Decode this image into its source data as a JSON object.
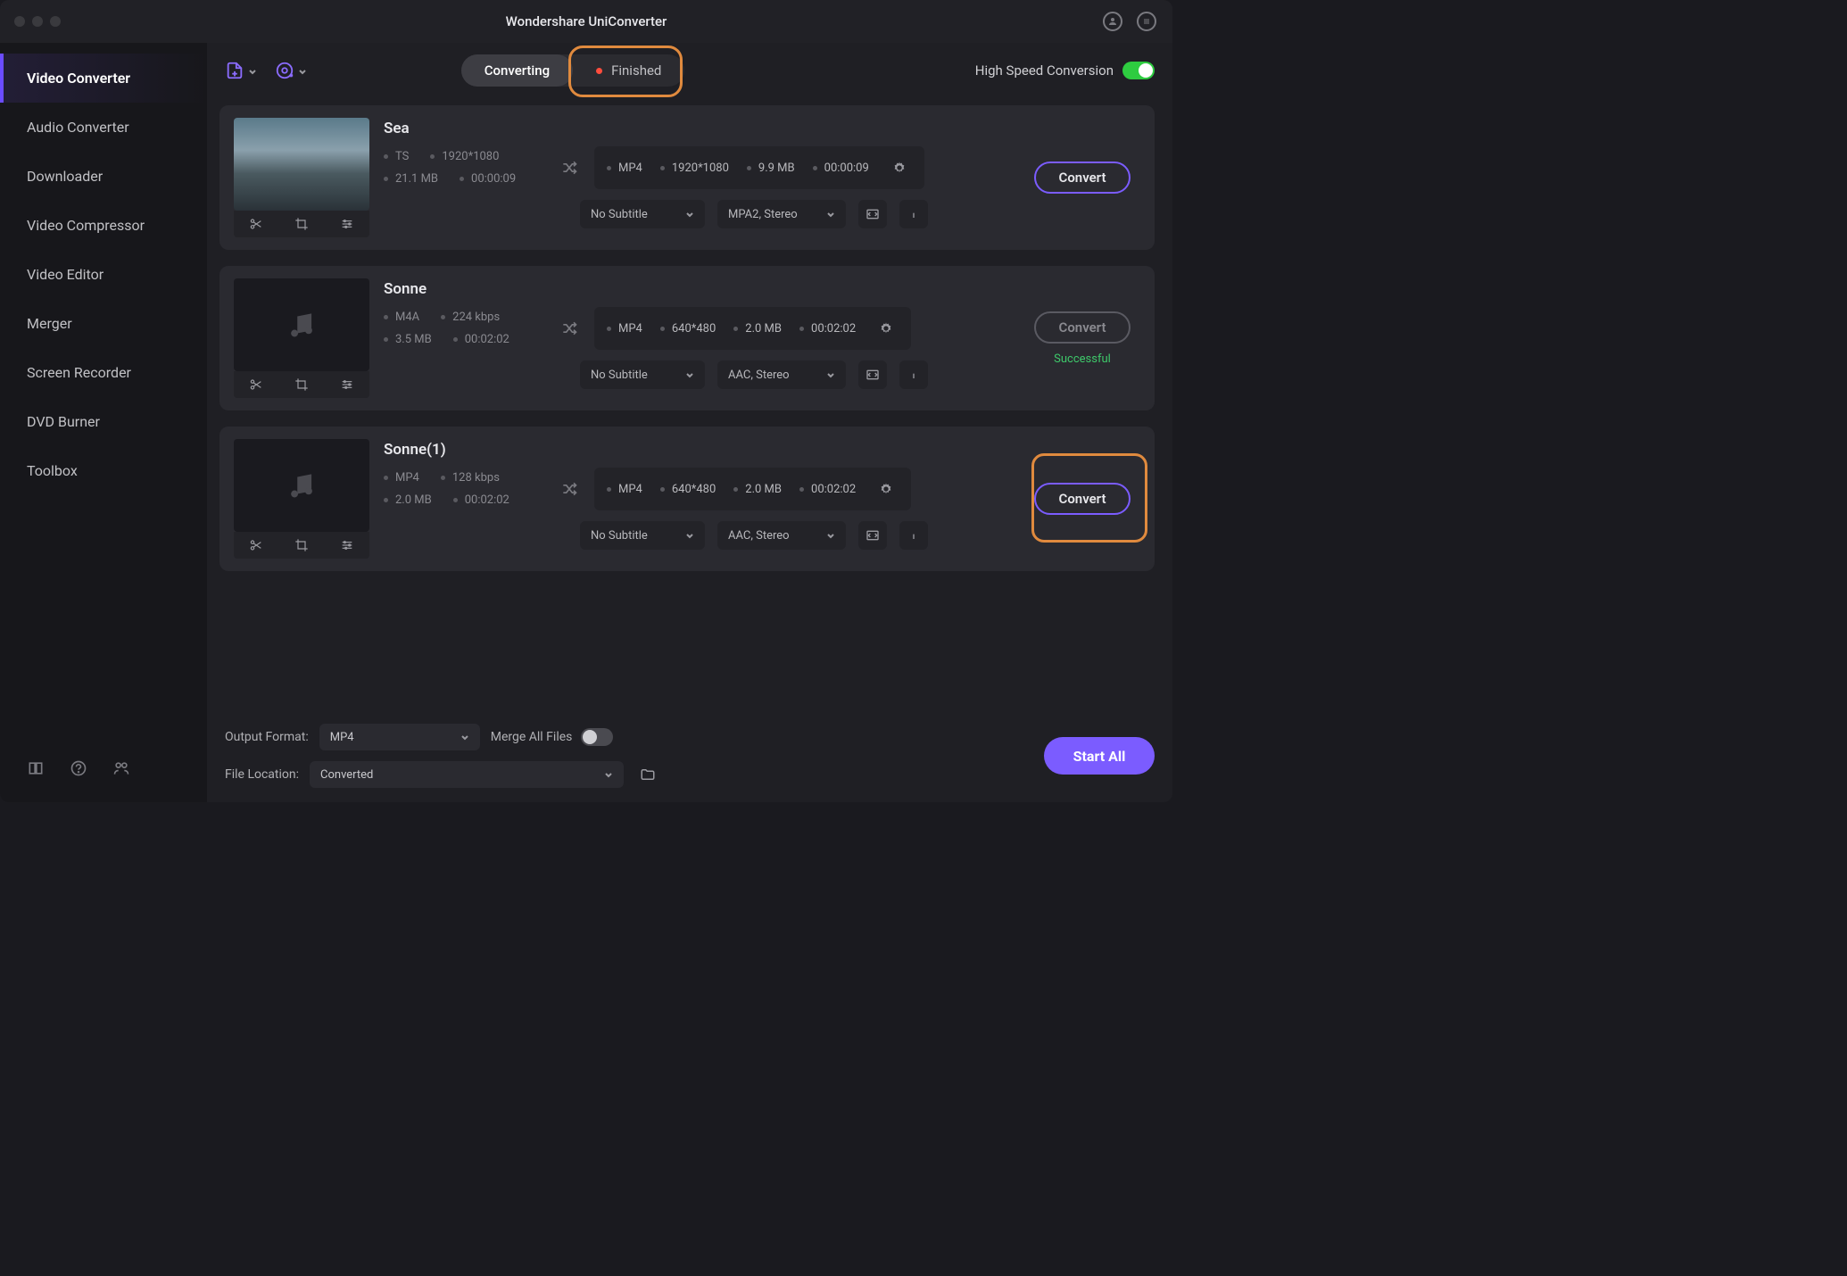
{
  "title": "Wondershare UniConverter",
  "sidebar": {
    "items": [
      {
        "label": "Video Converter",
        "active": true
      },
      {
        "label": "Audio Converter"
      },
      {
        "label": "Downloader"
      },
      {
        "label": "Video Compressor"
      },
      {
        "label": "Video Editor"
      },
      {
        "label": "Merger"
      },
      {
        "label": "Screen Recorder"
      },
      {
        "label": "DVD Burner"
      },
      {
        "label": "Toolbox"
      }
    ]
  },
  "topbar": {
    "seg": {
      "converting": "Converting",
      "finished": "Finished"
    },
    "hsconv": "High Speed Conversion"
  },
  "files": [
    {
      "name": "Sea",
      "thumb": "video",
      "src": {
        "fmt": "TS",
        "size": "21.1 MB",
        "res": "1920*1080",
        "dur": "00:00:09"
      },
      "out": {
        "fmt": "MP4",
        "res": "1920*1080",
        "size": "9.9 MB",
        "dur": "00:00:09"
      },
      "subtitle": "No Subtitle",
      "audio": "MPA2, Stereo",
      "btn": "Convert",
      "disabled": false,
      "status": "",
      "highlight": false
    },
    {
      "name": "Sonne",
      "thumb": "audio",
      "src": {
        "fmt": "M4A",
        "size": "3.5 MB",
        "res": "224 kbps",
        "dur": "00:02:02"
      },
      "out": {
        "fmt": "MP4",
        "res": "640*480",
        "size": "2.0 MB",
        "dur": "00:02:02"
      },
      "subtitle": "No Subtitle",
      "audio": "AAC, Stereo",
      "btn": "Convert",
      "disabled": true,
      "status": "Successful",
      "highlight": false
    },
    {
      "name": "Sonne(1)",
      "thumb": "audio",
      "src": {
        "fmt": "MP4",
        "size": "2.0 MB",
        "res": "128 kbps",
        "dur": "00:02:02"
      },
      "out": {
        "fmt": "MP4",
        "res": "640*480",
        "size": "2.0 MB",
        "dur": "00:02:02"
      },
      "subtitle": "No Subtitle",
      "audio": "AAC, Stereo",
      "btn": "Convert",
      "disabled": false,
      "status": "",
      "highlight": true
    }
  ],
  "footer": {
    "outfmt_label": "Output Format:",
    "outfmt": "MP4",
    "loc_label": "File Location:",
    "loc": "Converted",
    "merge": "Merge All Files",
    "start": "Start All"
  }
}
